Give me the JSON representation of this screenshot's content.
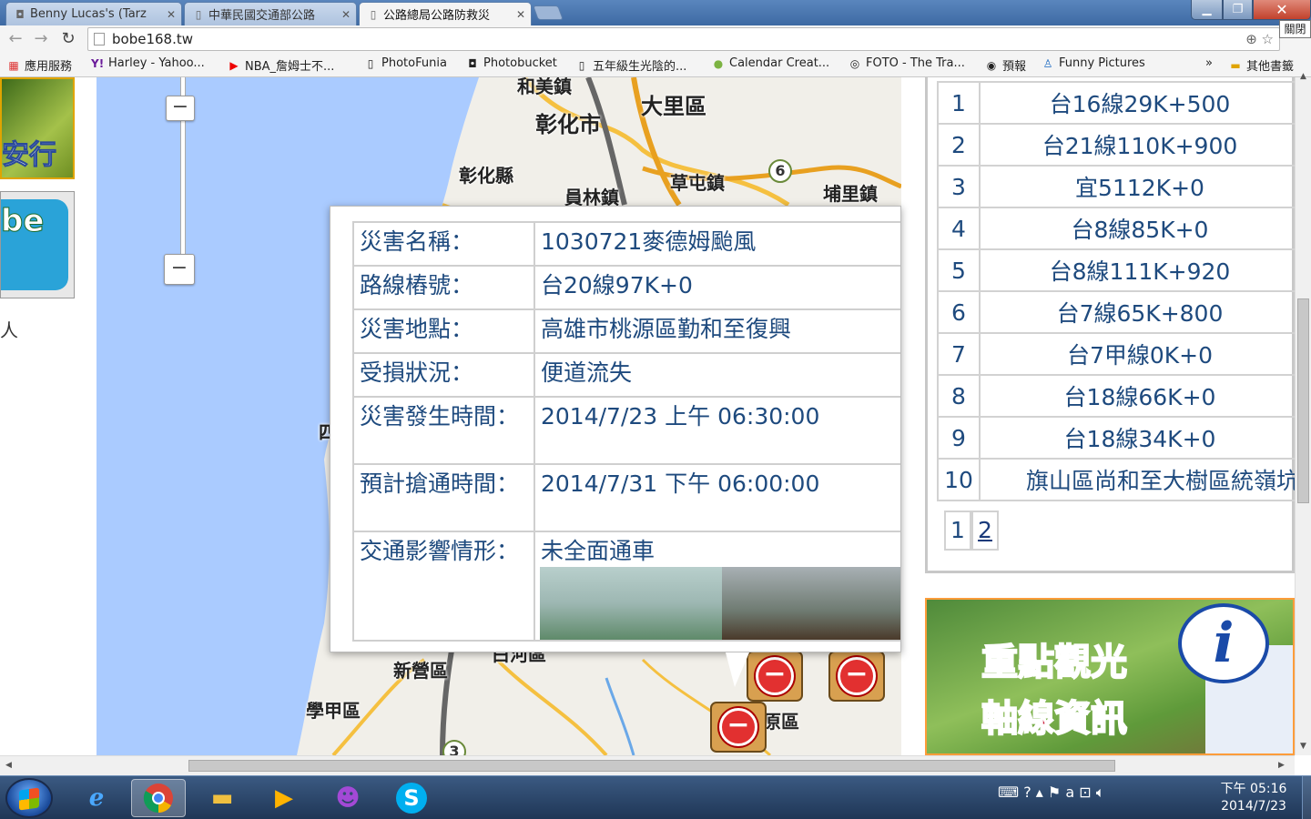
{
  "browser": {
    "tabs": [
      {
        "label": "Benny Lucas's (Tarz",
        "icon": "camera-icon"
      },
      {
        "label": "中華民國交通部公路",
        "icon": "page-icon"
      },
      {
        "label": "公路總局公路防救災",
        "icon": "page-icon"
      }
    ],
    "close_tooltip": "關閉",
    "address": "bobe168.tw",
    "bookmarks": [
      {
        "label": "應用服務",
        "icon": "apps-icon"
      },
      {
        "label": "Harley - Yahoo...",
        "icon": "yahoo-icon"
      },
      {
        "label": "NBA_詹姆士不...",
        "icon": "youtube-icon"
      },
      {
        "label": "PhotoFunia",
        "icon": "page-icon"
      },
      {
        "label": "Photobucket",
        "icon": "camera-icon"
      },
      {
        "label": "五年級生光陰的...",
        "icon": "page-icon"
      },
      {
        "label": "Calendar Creat...",
        "icon": "frog-icon"
      },
      {
        "label": "FOTO - The Tra...",
        "icon": "foto-icon"
      },
      {
        "label": "預報",
        "icon": "eye-icon"
      },
      {
        "label": "Funny Pictures",
        "icon": "person-icon"
      }
    ],
    "bookmarks_overflow": "»",
    "other_bookmarks": "其他書籤"
  },
  "left_sidebar": {
    "ad1_text": "安行",
    "ad2_text": "be",
    "caption": "人"
  },
  "map": {
    "labels": [
      "和美鎮",
      "彰化市",
      "大里區",
      "彰化縣",
      "員林鎮",
      "草屯鎮",
      "埔里鎮",
      "新營區",
      "學甲區",
      "原區",
      "白河區",
      "四"
    ],
    "route_shields": [
      "6",
      "3"
    ]
  },
  "popup": {
    "rows": [
      {
        "key": "災害名稱：",
        "value": "1030721麥德姆颱風"
      },
      {
        "key": "路線樁號：",
        "value": "台20線97K+0"
      },
      {
        "key": "災害地點：",
        "value": "高雄市桃源區勤和至復興"
      },
      {
        "key": "受損狀況：",
        "value": "便道流失"
      },
      {
        "key": "災害發生時間：",
        "value": "2014/7/23 上午 06:30:00"
      },
      {
        "key": "預計搶通時間：",
        "value": "2014/7/31 下午 06:00:00"
      },
      {
        "key": "交通影響情形：",
        "value": "未全面通車"
      }
    ]
  },
  "ranking": {
    "rows": [
      {
        "n": "1",
        "route": "台16線29K+500"
      },
      {
        "n": "2",
        "route": "台21線110K+900"
      },
      {
        "n": "3",
        "route": "宜5112K+0"
      },
      {
        "n": "4",
        "route": "台8線85K+0"
      },
      {
        "n": "5",
        "route": "台8線111K+920"
      },
      {
        "n": "6",
        "route": "台7線65K+800"
      },
      {
        "n": "7",
        "route": "台7甲線0K+0"
      },
      {
        "n": "8",
        "route": "台18線66K+0"
      },
      {
        "n": "9",
        "route": "台18線34K+0"
      },
      {
        "n": "10",
        "route": "旗山區尚和至大樹區統嶺坑"
      }
    ],
    "pages": [
      "1",
      "2"
    ]
  },
  "banner": {
    "line1": "重點觀光",
    "line2": "軸線資訊",
    "icon": "info-icon"
  },
  "taskbar": {
    "apps": [
      "start",
      "ie",
      "chrome",
      "explorer",
      "media-player",
      "yahoo-messenger",
      "skype"
    ],
    "clock_time": "下午 05:16",
    "clock_date": "2014/7/23"
  }
}
